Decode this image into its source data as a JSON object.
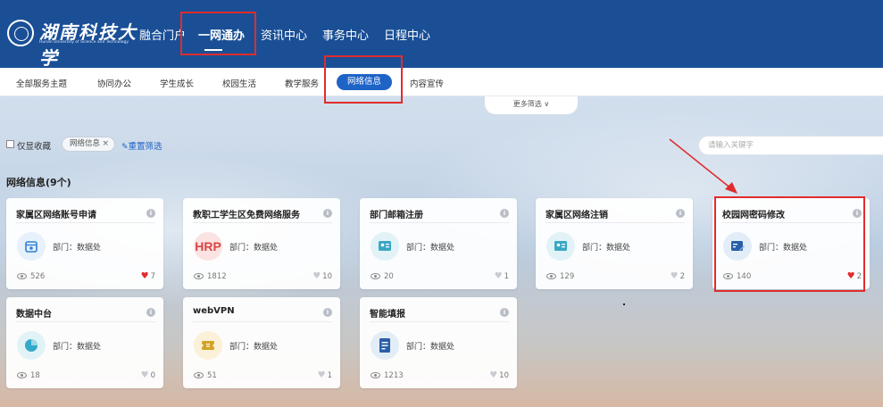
{
  "logo": {
    "cn": "湖南科技大学",
    "en": "Hunan University of Science and Technology"
  },
  "nav": {
    "items": [
      {
        "label": "融合门户",
        "active": false
      },
      {
        "label": "一网通办",
        "active": true
      },
      {
        "label": "资讯中心",
        "active": false
      },
      {
        "label": "事务中心",
        "active": false
      },
      {
        "label": "日程中心",
        "active": false
      }
    ]
  },
  "subnav": {
    "items": [
      "全部服务主题",
      "协同办公",
      "学生成长",
      "校园生活",
      "教学服务",
      "网络信息",
      "内容宣传"
    ],
    "active": "网络信息",
    "more": "更多筛选 ∨"
  },
  "filters": {
    "favorites_label": "仅显收藏",
    "chip_label": "网络信息",
    "chip_close": "×",
    "reset_label": "重置筛选",
    "search_placeholder": "请输入关键字"
  },
  "section_title": "网络信息(9个)",
  "cards": [
    {
      "title": "家属区网络账号申请",
      "dept": "部门：数据处",
      "views": "526",
      "likes": "7",
      "liked": true,
      "icon": "calendar-icon",
      "icon_bg": "#e6f1fb",
      "icon_color": "#2f7fd6"
    },
    {
      "title": "教职工学生区免费网络服务",
      "dept": "部门：数据处",
      "views": "1812",
      "likes": "10",
      "liked": false,
      "icon": "hrp-icon",
      "icon_bg": "#fbe3e3",
      "icon_color": "#d94545",
      "icon_text": "HRP"
    },
    {
      "title": "部门邮箱注册",
      "dept": "部门：数据处",
      "views": "20",
      "likes": "1",
      "liked": false,
      "icon": "id-card-icon",
      "icon_bg": "#e1f3f7",
      "icon_color": "#39a7c4"
    },
    {
      "title": "家属区网络注销",
      "dept": "部门：数据处",
      "views": "129",
      "likes": "2",
      "liked": false,
      "icon": "id-card-icon",
      "icon_bg": "#e1f3f7",
      "icon_color": "#39a7c4"
    },
    {
      "title": "校园网密码修改",
      "dept": "部门：数据处",
      "views": "140",
      "likes": "2",
      "liked": true,
      "icon": "edit-card-icon",
      "icon_bg": "#e3edf8",
      "icon_color": "#2a5fa8"
    },
    {
      "title": "数据中台",
      "dept": "部门：数据处",
      "views": "18",
      "likes": "0",
      "liked": false,
      "icon": "pie-chart-icon",
      "icon_bg": "#e1f3f7",
      "icon_color": "#33a9c8"
    },
    {
      "title": "webVPN",
      "dept": "部门：数据处",
      "views": "51",
      "likes": "1",
      "liked": false,
      "icon": "ticket-icon",
      "icon_bg": "#fbf1d9",
      "icon_color": "#d4a325"
    },
    {
      "title": "智能填报",
      "dept": "部门：数据处",
      "views": "1213",
      "likes": "10",
      "liked": false,
      "icon": "form-icon",
      "icon_bg": "#e3edf8",
      "icon_color": "#2a5fa8"
    }
  ],
  "colors": {
    "primary": "#1a4f96",
    "accent": "#1e63c6",
    "highlight": "#e02c2c"
  }
}
